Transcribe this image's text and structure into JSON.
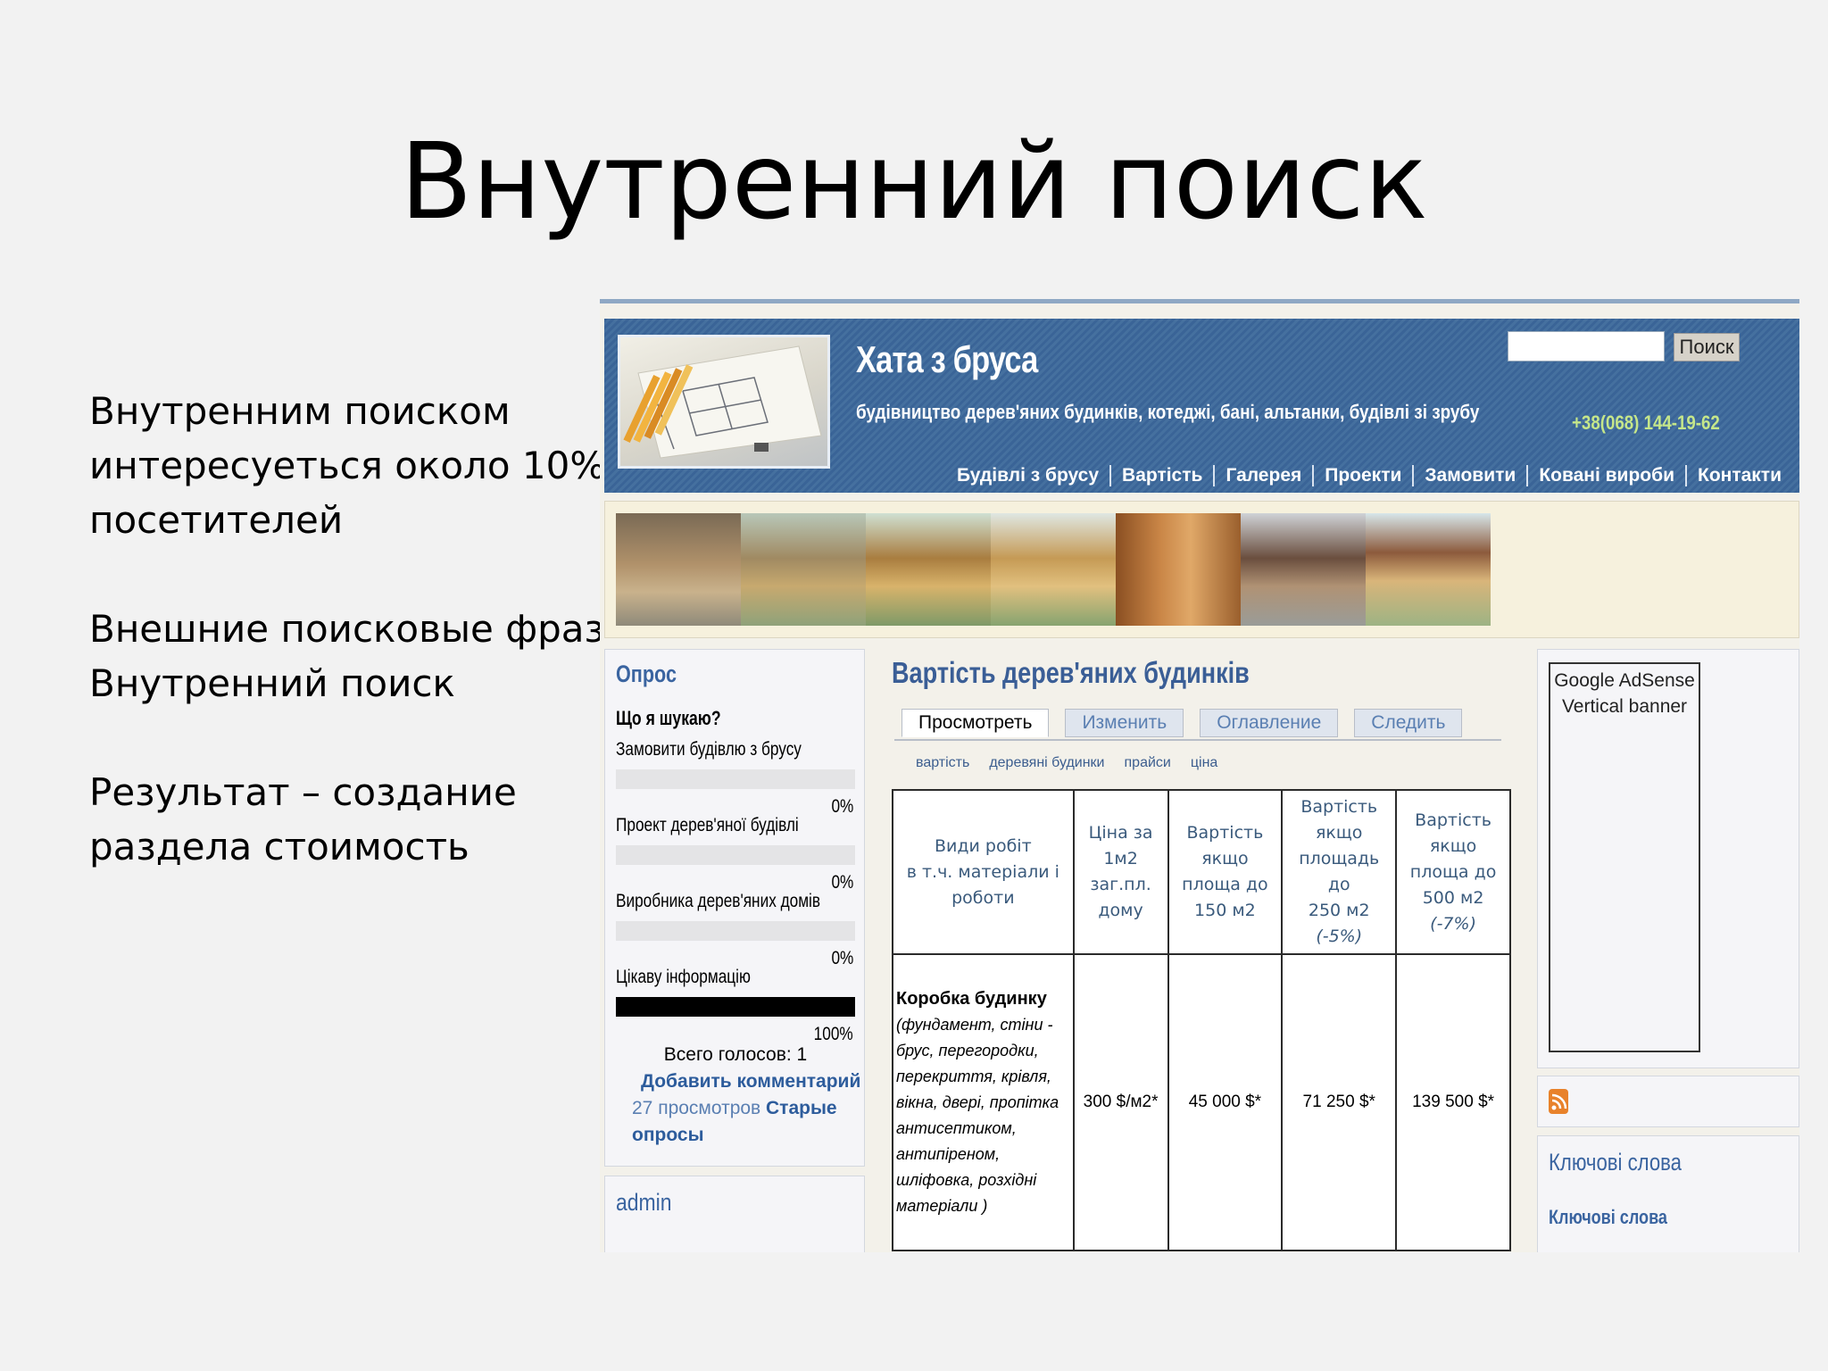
{
  "slide": {
    "title": "Внутренний поиск",
    "bullets": [
      [
        "Внутренним поиском",
        "интересуеться около 10%",
        "посетителей"
      ],
      [
        "Внешние поисковые фразы",
        "Внутренний поиск"
      ],
      [
        "Результат – создание",
        "раздела стоимость"
      ]
    ]
  },
  "site": {
    "title": "Хата з бруса",
    "tagline": "будівництво дерев'яних будинків, котеджі, бані, альтанки, будівлі зі зрубу",
    "search_button": "Поиск",
    "search_value": "",
    "phone": "+38(068) 144-19-62",
    "nav": [
      "Будівлі з брусу",
      "Вартість",
      "Галерея",
      "Проекти",
      "Замовити",
      "Ковані вироби",
      "Контакти"
    ]
  },
  "poll": {
    "title": "Опрос",
    "question": "Що я шукаю?",
    "options": [
      {
        "label": "Замовити будівлю з брусу",
        "pct": "0%",
        "fraction": 0
      },
      {
        "label": "Проект дерев'яної будівлі",
        "pct": "0%",
        "fraction": 0
      },
      {
        "label": "Виробника дерев'яних домів",
        "pct": "0%",
        "fraction": 0
      },
      {
        "label": "Цікаву інформацію",
        "pct": "100%",
        "fraction": 1
      }
    ],
    "total": "Всего голосов: 1",
    "add_comment": "Добавить комментарий",
    "views": "27 просмотров",
    "old_polls_1": "Старые",
    "old_polls_2": "опросы"
  },
  "admin": {
    "title": "admin"
  },
  "main": {
    "title": "Вартість дерев'яних будинків",
    "tabs": [
      "Просмотреть",
      "Изменить",
      "Оглавление",
      "Следить"
    ],
    "tags": [
      "вартість",
      "деревяні будинки",
      "прайси",
      "ціна"
    ],
    "table": {
      "headers": [
        [
          "Види робіт",
          "в т.ч. матеріали і",
          "роботи"
        ],
        [
          "Ціна за",
          "1м2",
          "заг.пл.",
          "дому"
        ],
        [
          "Вартість",
          "якщо",
          "площа до",
          "150 м2"
        ],
        [
          "Вартість",
          "якщо",
          "площадь",
          "до",
          "250 м2",
          "(-5%)"
        ],
        [
          "Вартість",
          "якщо",
          "площа до",
          "500 м2",
          "(-7%)"
        ]
      ],
      "row": {
        "work_title": "Коробка будинку",
        "work_desc": [
          "(фундамент, стіни -",
          "брус, перегородки,",
          "перекриття, крівля,",
          "вікна, двері, пропітка",
          "антисептиком,",
          "антипіреном,",
          "шліфовка, розхідні",
          "матеріали )"
        ],
        "price": "300 $/м2*",
        "v150": "45 000 $*",
        "v250": "71 250 $*",
        "v500": "139 500 $*"
      }
    }
  },
  "right": {
    "ad_line1": "Google AdSense",
    "ad_line2": "Vertical banner",
    "kw_title": "Ключові слова",
    "kw_link": "Ключові слова"
  },
  "colors": {
    "header_blue": "#3a6497",
    "link_blue": "#3a64a0",
    "phone_green": "#c5e68a",
    "rss_orange": "#e8822b"
  }
}
